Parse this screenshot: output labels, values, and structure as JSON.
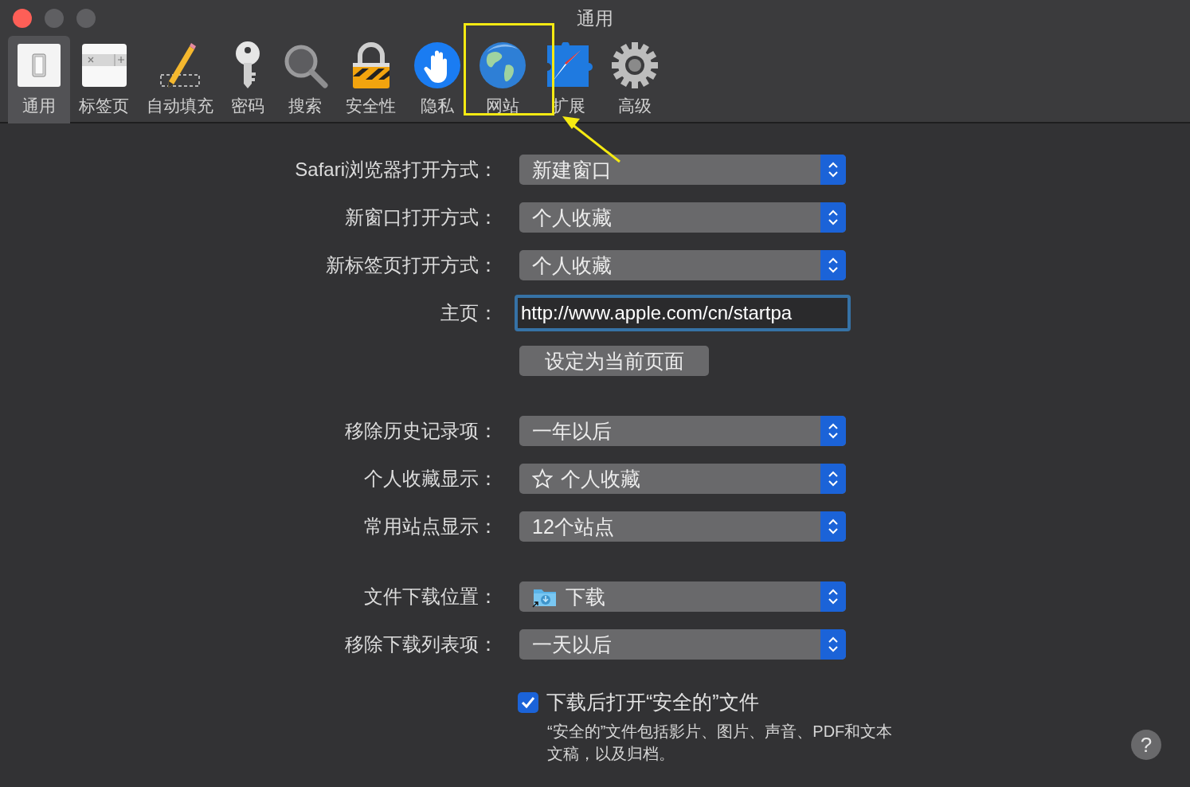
{
  "window": {
    "title": "通用"
  },
  "toolbar": [
    {
      "label": "通用",
      "selected": true
    },
    {
      "label": "标签页",
      "selected": false
    },
    {
      "label": "自动填充",
      "selected": false
    },
    {
      "label": "密码",
      "selected": false
    },
    {
      "label": "搜索",
      "selected": false
    },
    {
      "label": "安全性",
      "selected": false
    },
    {
      "label": "隐私",
      "selected": false
    },
    {
      "label": "网站",
      "selected": false
    },
    {
      "label": "扩展",
      "selected": false
    },
    {
      "label": "高级",
      "selected": false
    }
  ],
  "sections": [
    [
      {
        "kind": "popup",
        "label": "Safari浏览器打开方式：",
        "value": "新建窗口"
      },
      {
        "kind": "popup",
        "label": "新窗口打开方式：",
        "value": "个人收藏"
      },
      {
        "kind": "popup",
        "label": "新标签页打开方式：",
        "value": "个人收藏"
      },
      {
        "kind": "field",
        "label": "主页：",
        "value": "http://www.apple.com/cn/startpa"
      },
      {
        "kind": "button",
        "value": "设定为当前页面"
      }
    ],
    [
      {
        "kind": "popup",
        "label": "移除历史记录项：",
        "value": "一年以后"
      },
      {
        "kind": "starpopup",
        "label": "个人收藏显示：",
        "value": "个人收藏"
      },
      {
        "kind": "popup",
        "label": "常用站点显示：",
        "value": "12个站点"
      }
    ],
    [
      {
        "kind": "folderpopup",
        "label": "文件下载位置：",
        "value": "下载"
      },
      {
        "kind": "popup",
        "label": "移除下载列表项：",
        "value": "一天以后"
      }
    ]
  ],
  "checkbox": {
    "label": "下载后打开“安全的”文件",
    "checked": true,
    "note": "“安全的”文件包括影片、图片、声音、PDF和文本文稿，以及归档。"
  },
  "help": "?"
}
